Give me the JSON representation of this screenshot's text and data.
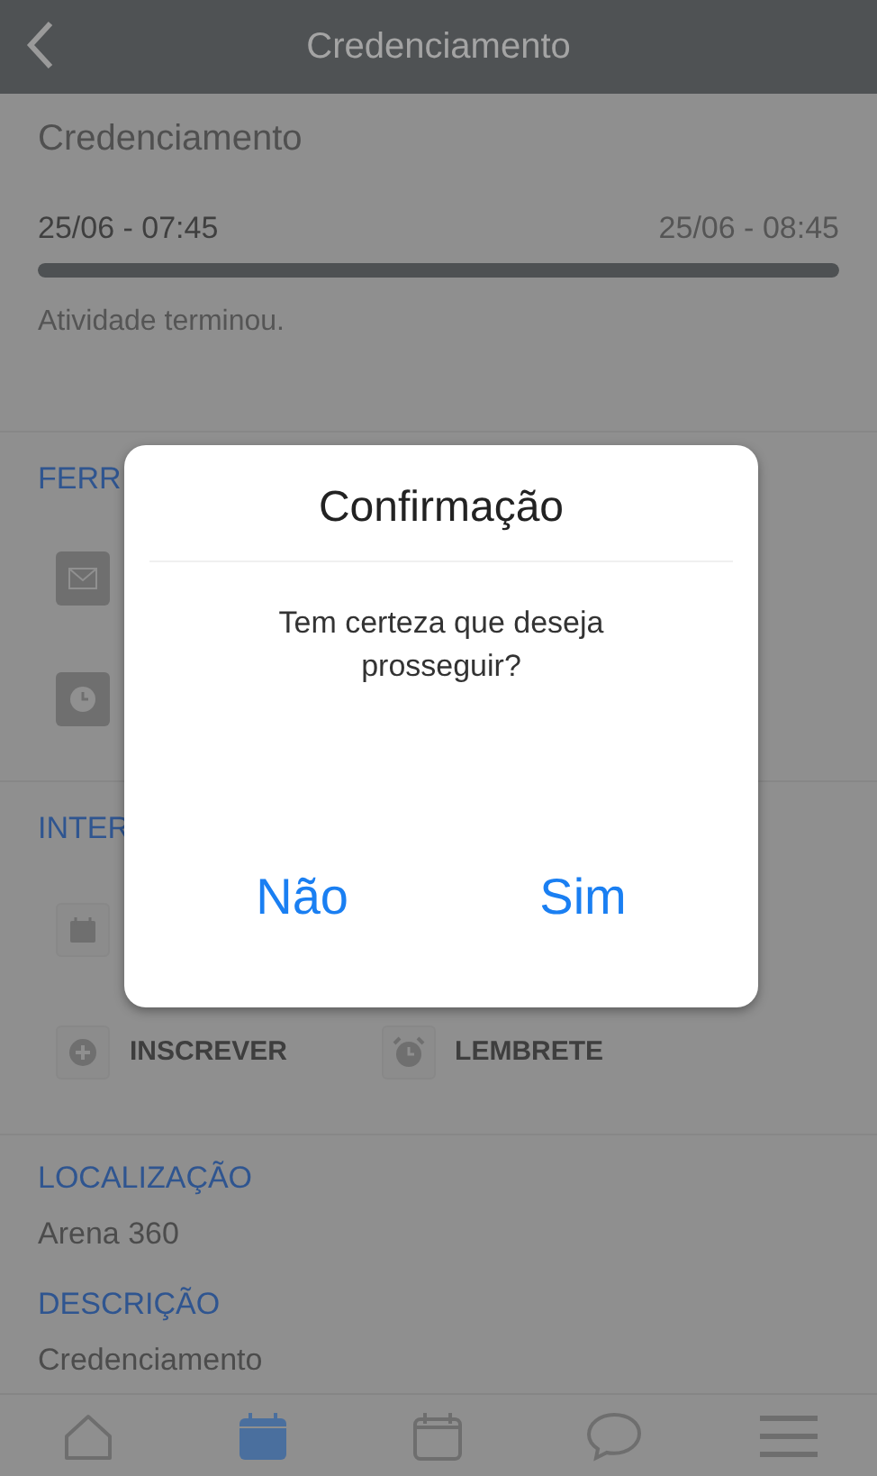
{
  "header": {
    "title": "Credenciamento"
  },
  "activity": {
    "title": "Credenciamento",
    "start": "25/06 - 07:45",
    "end": "25/06 - 08:45",
    "progress": {
      "level": 1
    },
    "status": "Atividade terminou."
  },
  "sections": [
    {
      "heading": "FERR",
      "kind": "tools",
      "items": [
        {
          "kind": "envelope"
        },
        {
          "kind": "clock"
        }
      ]
    },
    {
      "heading": "INTER",
      "kind": "actions",
      "items": [
        {
          "kind": "calendar"
        }
      ],
      "buttons": [
        {
          "kind": "plus",
          "label": "INSCREVER"
        },
        {
          "kind": "alarm",
          "label": "LEMBRETE"
        }
      ]
    },
    {
      "heading": "LOCALIZAÇÃO",
      "kind": "text",
      "text": "Arena 360"
    },
    {
      "heading": "DESCRIÇÃO",
      "kind": "text",
      "text": "Credenciamento"
    }
  ],
  "dialog": {
    "title": "Confirmação",
    "message": "Tem certeza que deseja prosseguir?",
    "buttons": [
      "Não",
      "Sim"
    ]
  },
  "tabs": [
    {
      "kind": "home",
      "selected": false
    },
    {
      "kind": "calendar",
      "selected": true
    },
    {
      "kind": "calendar",
      "selected": false
    },
    {
      "kind": "chat",
      "selected": false
    },
    {
      "kind": "menu",
      "selected": false
    }
  ]
}
